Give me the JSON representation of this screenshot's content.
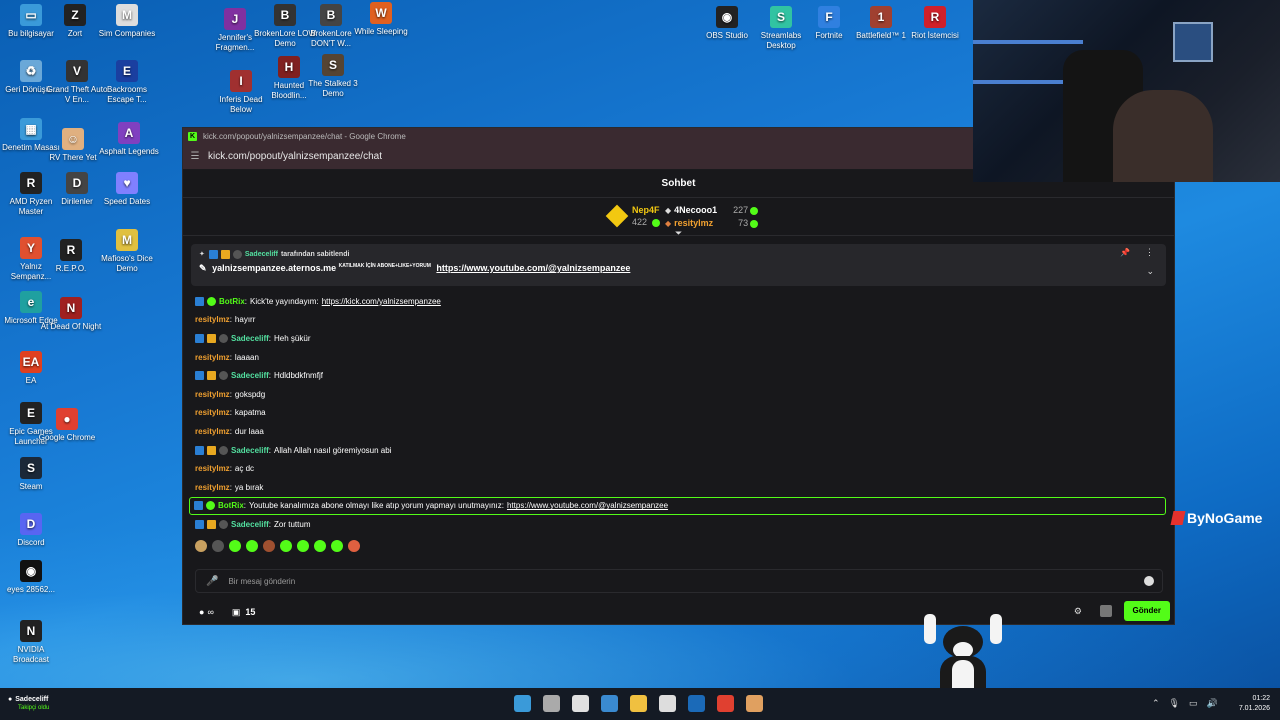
{
  "desktop": {
    "icons": [
      {
        "label": "Bu bilgisayar",
        "color": "#3a9ad9",
        "glyph": "▭"
      },
      {
        "label": "Zort",
        "color": "#222",
        "glyph": "Z"
      },
      {
        "label": "Sim Companies",
        "color": "#ddd",
        "glyph": "M"
      },
      {
        "label": "Geri Dönüşü...",
        "color": "#6aa8d8",
        "glyph": "♻"
      },
      {
        "label": "Grand Theft Auto V En...",
        "color": "#333",
        "glyph": "V"
      },
      {
        "label": "Backrooms Escape T...",
        "color": "#1a3fa0",
        "glyph": "E"
      },
      {
        "label": "Denetim Masası",
        "color": "#3a9ad9",
        "glyph": "▦"
      },
      {
        "label": "RV There Yet",
        "color": "#e0b080",
        "glyph": "☺"
      },
      {
        "label": "Asphalt Legends",
        "color": "#8040c0",
        "glyph": "A"
      },
      {
        "label": "AMD Ryzen Master",
        "color": "#222",
        "glyph": "R"
      },
      {
        "label": "Dirilenler",
        "color": "#444",
        "glyph": "D"
      },
      {
        "label": "Speed Dates",
        "color": "#8080ff",
        "glyph": "♥"
      },
      {
        "label": "Yalnız Sempanz...",
        "color": "#e05030",
        "glyph": "Y"
      },
      {
        "label": "R.E.P.O.",
        "color": "#222",
        "glyph": "R"
      },
      {
        "label": "Mafioso's Dice Demo",
        "color": "#e0c040",
        "glyph": "M"
      },
      {
        "label": "Microsoft Edge",
        "color": "#1fa0a0",
        "glyph": "e"
      },
      {
        "label": "At Dead Of Night",
        "color": "#a02020",
        "glyph": "N"
      },
      {
        "label": "EA",
        "color": "#e04020",
        "glyph": "EA"
      },
      {
        "label": "Epic Games Launcher",
        "color": "#222",
        "glyph": "E"
      },
      {
        "label": "Google Chrome",
        "color": "#e04030",
        "glyph": "●"
      },
      {
        "label": "Steam",
        "color": "#1b2838",
        "glyph": "S"
      },
      {
        "label": "Discord",
        "color": "#5865f2",
        "glyph": "D"
      },
      {
        "label": "eyes 28562...",
        "color": "#111",
        "glyph": "◉"
      },
      {
        "label": "NVIDIA Broadcast",
        "color": "#222",
        "glyph": "N"
      },
      {
        "label": "Jennifer's Fragmen...",
        "color": "#8030a0",
        "glyph": "J"
      },
      {
        "label": "BrokenLore LOW Demo",
        "color": "#333",
        "glyph": "B"
      },
      {
        "label": "BrokenLore DON'T W...",
        "color": "#444",
        "glyph": "B"
      },
      {
        "label": "While Sleeping",
        "color": "#e06020",
        "glyph": "W"
      },
      {
        "label": "Haunted Bloodlin...",
        "color": "#802020",
        "glyph": "H"
      },
      {
        "label": "The Stalked 3 Demo",
        "color": "#554433",
        "glyph": "S"
      },
      {
        "label": "Inferis Dead Below",
        "color": "#a03030",
        "glyph": "I"
      },
      {
        "label": "OBS Studio",
        "color": "#222",
        "glyph": "◉"
      },
      {
        "label": "Streamlabs Desktop",
        "color": "#31c3a2",
        "glyph": "S"
      },
      {
        "label": "Fortnite",
        "color": "#3080e0",
        "glyph": "F"
      },
      {
        "label": "Battlefield™ 1",
        "color": "#a04030",
        "glyph": "1"
      },
      {
        "label": "Riot İstemcisi",
        "color": "#d0202a",
        "glyph": "R"
      }
    ]
  },
  "window": {
    "title": "kick.com/popout/yalnizsempanzee/chat - Google Chrome",
    "url": "kick.com/popout/yalnizsempanzee/chat"
  },
  "chat": {
    "header": "Sohbet",
    "top_gifters": {
      "first": {
        "name": "Nep4F",
        "count": "422"
      },
      "second": {
        "name": "4Necooo1",
        "count": "227"
      },
      "third": {
        "name": "resitylmz",
        "count": "73"
      }
    },
    "pinned": {
      "by_user": "Sadeceliff",
      "by_suffix": "tarafından sabitlendi",
      "text": "yalnizsempanzee.aternos.me",
      "small_caps": "KATILMAK İÇİN ABONE+LIKE+YORUM",
      "link": "https://www.youtube.com/@yalnizsempanzee"
    },
    "messages": [
      {
        "user": "BotRix",
        "user_color": "#53fc18",
        "badges": [
          "blue",
          "green"
        ],
        "text": "Kick'te yayındayım:",
        "link": "https://kick.com/yalnizsempanzee",
        "highlight": false
      },
      {
        "user": "resitylmz",
        "user_color": "#f0a030",
        "badges": [],
        "text": "hayırr",
        "link": "",
        "highlight": false
      },
      {
        "user": "Sadeceliff",
        "user_color": "#53e0a0",
        "badges": [
          "blue",
          "gold",
          "gray"
        ],
        "text": "Heh şükür",
        "link": "",
        "highlight": false
      },
      {
        "user": "resitylmz",
        "user_color": "#f0a030",
        "badges": [],
        "text": "laaaan",
        "link": "",
        "highlight": false
      },
      {
        "user": "Sadeceliff",
        "user_color": "#53e0a0",
        "badges": [
          "blue",
          "gold",
          "gray"
        ],
        "text": "Hdldbdkfnmfjf",
        "link": "",
        "highlight": false
      },
      {
        "user": "resitylmz",
        "user_color": "#f0a030",
        "badges": [],
        "text": "gokspdg",
        "link": "",
        "highlight": false
      },
      {
        "user": "resitylmz",
        "user_color": "#f0a030",
        "badges": [],
        "text": "kapatma",
        "link": "",
        "highlight": false
      },
      {
        "user": "resitylmz",
        "user_color": "#f0a030",
        "badges": [],
        "text": "dur laaa",
        "link": "",
        "highlight": false
      },
      {
        "user": "Sadeceliff",
        "user_color": "#53e0a0",
        "badges": [
          "blue",
          "gold",
          "gray"
        ],
        "text": "Allah Allah nasıl göremiyosun abi",
        "link": "",
        "highlight": false
      },
      {
        "user": "resitylmz",
        "user_color": "#f0a030",
        "badges": [],
        "text": "aç dc",
        "link": "",
        "highlight": false
      },
      {
        "user": "resitylmz",
        "user_color": "#f0a030",
        "badges": [],
        "text": "ya bırak",
        "link": "",
        "highlight": false
      },
      {
        "user": "BotRix",
        "user_color": "#53fc18",
        "badges": [
          "blue",
          "green"
        ],
        "text": "Youtube kanalımıza abone olmayı like atıp yorum yapmayı unutmayınız:",
        "link": "https://www.youtube.com/@yalnizsempanzee",
        "highlight": true
      },
      {
        "user": "Sadeceliff",
        "user_color": "#53e0a0",
        "badges": [
          "blue",
          "gold",
          "gray"
        ],
        "text": "Zor tuttum",
        "link": "",
        "highlight": false
      }
    ],
    "emote_colors": [
      "#c8a060",
      "#555",
      "#53fc18",
      "#53fc18",
      "#a05030",
      "#53fc18",
      "#53fc18",
      "#53fc18",
      "#53fc18",
      "#e06040"
    ],
    "input_placeholder": "Bir mesaj gönderin",
    "footer": {
      "infinity": "∞",
      "sub_count": "15",
      "send_label": "Gönder"
    }
  },
  "overlay": {
    "watermark": "ByNoGame"
  },
  "taskbar": {
    "follower_name": "Sadeceliff",
    "follower_sub": "Takipçi oldu",
    "time": "01:22",
    "date": "7.01.2026",
    "app_colors": [
      "#3a9ad9",
      "#aaa",
      "#e0e0e0",
      "#3a8ad0",
      "#f0c040",
      "#ddd",
      "#1b6ab8",
      "#e04030",
      "#e0a060"
    ]
  }
}
